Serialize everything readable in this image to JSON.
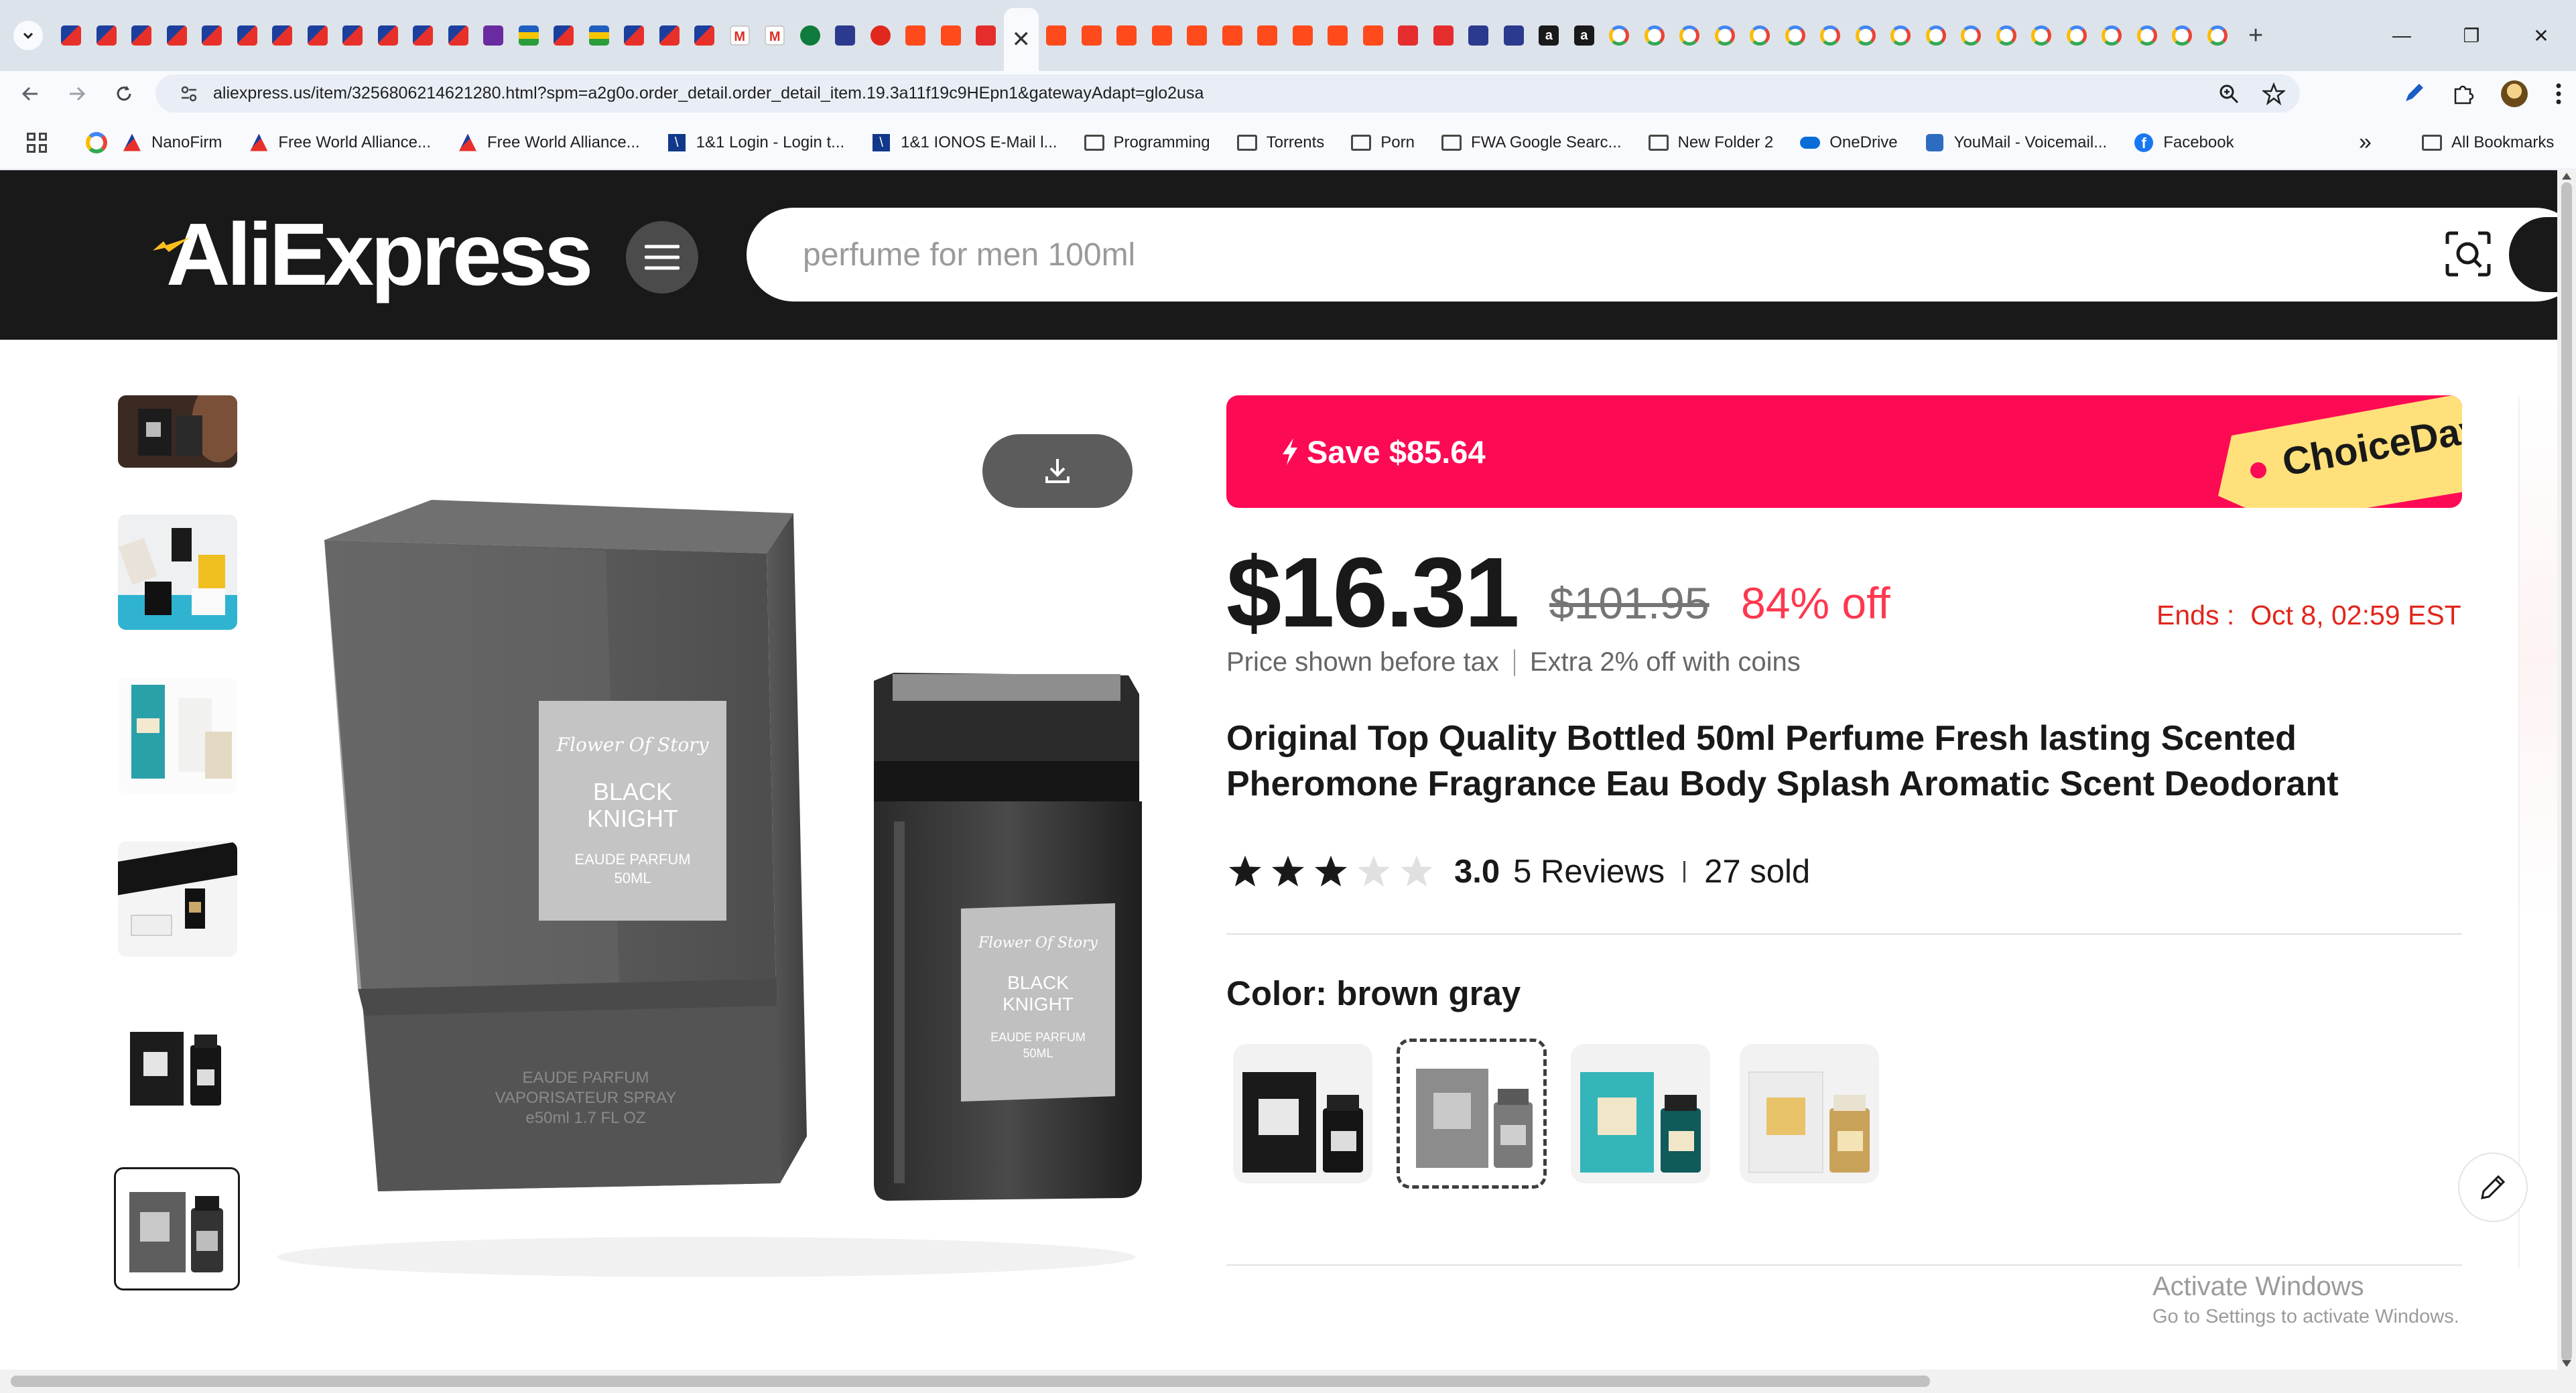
{
  "browser": {
    "address": "aliexpress.us/item/3256806214621280.html?spm=a2g0o.order_detail.order_detail_item.19.3a11f19c9HEpn1&gatewayAdapt=glo2usa",
    "bookmarks": [
      {
        "label": "NanoFirm",
        "icon": "fwa-icon"
      },
      {
        "label": "Free World Alliance...",
        "icon": "fwa-icon"
      },
      {
        "label": "Free World Alliance...",
        "icon": "fwa-icon"
      },
      {
        "label": "1&1 Login - Login t...",
        "icon": "ionos-icon"
      },
      {
        "label": "1&1 IONOS E-Mail l...",
        "icon": "ionos-icon"
      },
      {
        "label": "Programming",
        "icon": "folder-icon"
      },
      {
        "label": "Torrents",
        "icon": "folder-icon"
      },
      {
        "label": "Porn",
        "icon": "folder-icon"
      },
      {
        "label": "FWA Google Searc...",
        "icon": "folder-icon"
      },
      {
        "label": "New Folder 2",
        "icon": "folder-icon"
      },
      {
        "label": "OneDrive",
        "icon": "onedrive-icon"
      },
      {
        "label": "YouMail - Voicemail...",
        "icon": "youmail-icon"
      },
      {
        "label": "Facebook",
        "icon": "facebook-icon"
      }
    ],
    "all_bookmarks_label": "All Bookmarks",
    "bookmarks_overflow": "»",
    "colors": {
      "tabstrip": "#dde3ea",
      "toolbar": "#f8fafd"
    }
  },
  "site": {
    "logo_text": "AliExpress",
    "search_placeholder": "perfume for men 100ml",
    "colors": {
      "header": "#191919",
      "accent": "#fd0a54",
      "price_red": "#fd384f"
    }
  },
  "product": {
    "save_banner": "Save $85.64",
    "promo_tag": "ChoiceDay",
    "price": "$16.31",
    "original_price": "$101.95",
    "discount": "84% off",
    "ends_label": "Ends :",
    "ends_value": "Oct 8, 02:59 EST",
    "tax_note": "Price shown before tax",
    "coins_note": "Extra 2% off with coins",
    "title": "Original Top Quality Bottled 50ml Perfume Fresh lasting Scented Pheromone Fragrance Eau Body Splash Aromatic Scent Deodorant",
    "rating_value": 3,
    "rating_max": 5,
    "rating": "3.0",
    "reviews": "5 Reviews",
    "sold": "27 sold",
    "color_label": "Color: brown gray",
    "color_options_selected_index": 1,
    "box_label": {
      "brand": "Flower Of Story",
      "name_line1": "BLACK",
      "name_line2": "KNIGHT",
      "type": "EAUDE PARFUM",
      "volume": "50ML",
      "bottom_line1": "EAUDE PARFUM",
      "bottom_line2": "VAPORISATEUR SPRAY",
      "bottom_line3": "e50ml  1.7 FL OZ"
    },
    "bottle_label": {
      "brand": "Flower Of Story",
      "name_line1": "BLACK",
      "name_line2": "KNIGHT",
      "type": "EAUDE PARFUM",
      "volume": "50ML"
    }
  },
  "watermark": {
    "line1": "Activate Windows",
    "line2": "Go to Settings to activate Windows."
  }
}
